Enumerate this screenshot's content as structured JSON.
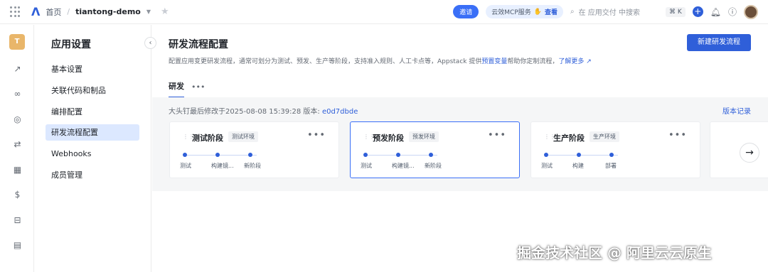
{
  "topbar": {
    "home": "首页",
    "separator": "/",
    "app_name": "tiantong-demo",
    "invite_label": "邀请",
    "mcp_label": "云效MCP服务",
    "mcp_view": "查看",
    "search_placeholder": "在 应用交付 中搜索",
    "shortcut": "⌘ K"
  },
  "rail": {
    "project_initial": "T"
  },
  "sidenav": {
    "title": "应用设置",
    "items": [
      {
        "label": "基本设置"
      },
      {
        "label": "关联代码和制品"
      },
      {
        "label": "编排配置"
      },
      {
        "label": "研发流程配置",
        "active": true
      },
      {
        "label": "Webhooks"
      },
      {
        "label": "成员管理"
      }
    ]
  },
  "main": {
    "title": "研发流程配置",
    "description_prefix": "配置应用变更研发流程，通常可划分为测试、预发、生产等阶段，支持准入规则、人工卡点等，Appstack 提供",
    "description_link": "预置变量",
    "description_suffix": "帮助你定制流程，",
    "learn_more": "了解更多",
    "new_button": "新建研发流程",
    "tab_label": "研发",
    "tab_more": "•••",
    "meta_text": "大头钉最后修改于2025-08-08 15:39:28  版本: ",
    "version": "e0d7dbde",
    "history_label": "版本记录"
  },
  "stages": [
    {
      "name": "测试阶段",
      "env": "测试环境",
      "jobs": [
        "测试",
        "构建镜...",
        "新阶段"
      ]
    },
    {
      "name": "预发阶段",
      "env": "预发环境",
      "jobs": [
        "测试",
        "构建镜...",
        "新阶段"
      ]
    },
    {
      "name": "生产阶段",
      "env": "生产环境",
      "jobs": [
        "测试",
        "构建",
        "部署"
      ]
    }
  ],
  "watermark": "掘金技术社区 @ 阿里云云原生",
  "colors": {
    "accent": "#2f5fd9",
    "active_nav": "#dce8ff",
    "canvas": "#f5f6f7"
  }
}
